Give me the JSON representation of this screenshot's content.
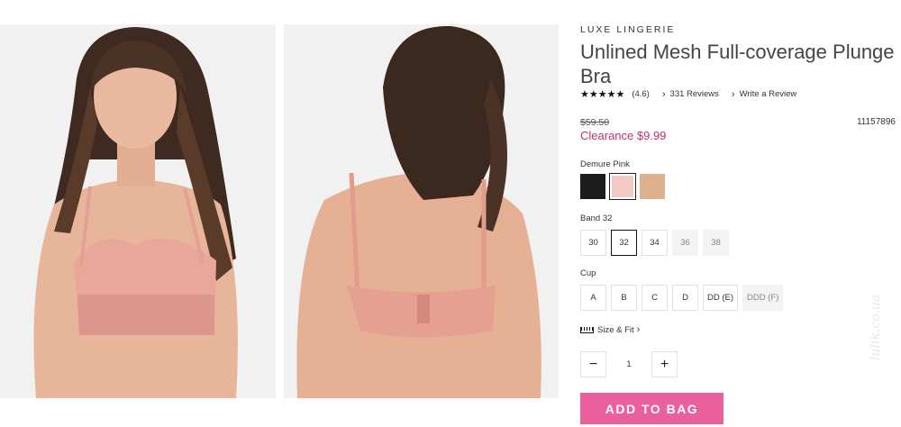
{
  "product": {
    "brand": "LUXE LINGERIE",
    "title": "Unlined Mesh Full-coverage Plunge Bra",
    "stars": "★★★★★",
    "rating": "(4.6)",
    "reviews_link": "331 Reviews",
    "write_review_link": "Write a Review",
    "original_price": "$59.50",
    "sale_price": "Clearance $9.99",
    "sku": "11157896"
  },
  "images": [
    {
      "name": "Front view"
    },
    {
      "name": "Back view"
    }
  ],
  "colors": {
    "label": "Demure Pink",
    "swatches": [
      {
        "name": "Black",
        "hex": "#1c1c1c",
        "selected": false
      },
      {
        "name": "Demure Pink",
        "hex": "#f3c9c4",
        "selected": true
      },
      {
        "name": "Nude",
        "hex": "#ddb08e",
        "selected": false
      }
    ]
  },
  "band": {
    "label": "Band 32",
    "options": [
      {
        "label": "30",
        "state": "available"
      },
      {
        "label": "32",
        "state": "selected"
      },
      {
        "label": "34",
        "state": "available"
      },
      {
        "label": "36",
        "state": "unavailable"
      },
      {
        "label": "38",
        "state": "unavailable"
      }
    ]
  },
  "cup": {
    "label": "Cup",
    "options": [
      {
        "label": "A",
        "state": "available"
      },
      {
        "label": "B",
        "state": "available"
      },
      {
        "label": "C",
        "state": "available"
      },
      {
        "label": "D",
        "state": "available"
      },
      {
        "label": "DD (E)",
        "state": "available"
      },
      {
        "label": "DDD (F)",
        "state": "unavailable"
      }
    ]
  },
  "size_fit": {
    "label": "Size & Fit",
    "icon": "ruler-icon"
  },
  "quantity": {
    "value": "1",
    "minus": "−",
    "plus": "+"
  },
  "add_to_bag": "ADD TO BAG",
  "watermark": "lulik.co.ua",
  "chevron": "›"
}
